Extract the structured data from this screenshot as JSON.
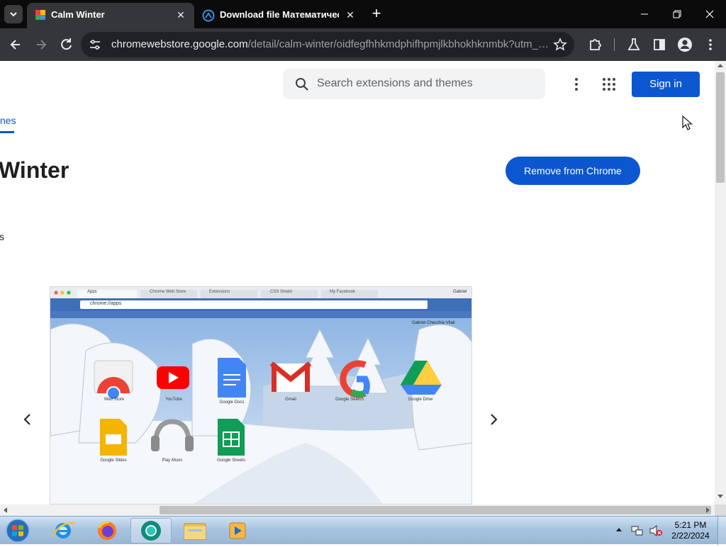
{
  "browser": {
    "tabs": [
      {
        "title": "Calm Winter",
        "active": true
      },
      {
        "title": "Download file Математически",
        "active": false
      }
    ],
    "url_host": "chromewebstore.google.com",
    "url_path": "/detail/calm-winter/oidfegfhhkmdphifhpmjlkbhokhknmbk?utm_sourc..."
  },
  "store": {
    "search_placeholder": "Search extensions and themes",
    "signin_label": "Sign in",
    "tab_themes_label": "nes",
    "title": "Winter",
    "remove_label": "Remove from Chrome",
    "side_text": "s"
  },
  "screenshot": {
    "tabs": [
      "Apps",
      "Chrome Web Store",
      "Extensions",
      "CSS Shield",
      "My Facebook"
    ],
    "address": "chrome://apps",
    "user": "Gabriel Checchia Vitali",
    "profile_name": "Gabriel",
    "apps": [
      {
        "name": "Web Store",
        "icon": "webstore-icon"
      },
      {
        "name": "YouTube",
        "icon": "youtube-icon"
      },
      {
        "name": "Google Docs",
        "icon": "docs-icon"
      },
      {
        "name": "Gmail",
        "icon": "gmail-icon"
      },
      {
        "name": "Google Search",
        "icon": "google-icon"
      },
      {
        "name": "Google Drive",
        "icon": "drive-icon"
      },
      {
        "name": "Google Slides",
        "icon": "slides-icon"
      },
      {
        "name": "Play Music",
        "icon": "headphones-icon"
      },
      {
        "name": "Google Sheets",
        "icon": "sheets-icon"
      }
    ]
  },
  "taskbar": {
    "time": "5:21 PM",
    "date": "2/22/2024"
  },
  "colors": {
    "accent": "#0b57d0",
    "tabstrip": "#0b0b0c",
    "toolbar": "#35363a"
  }
}
